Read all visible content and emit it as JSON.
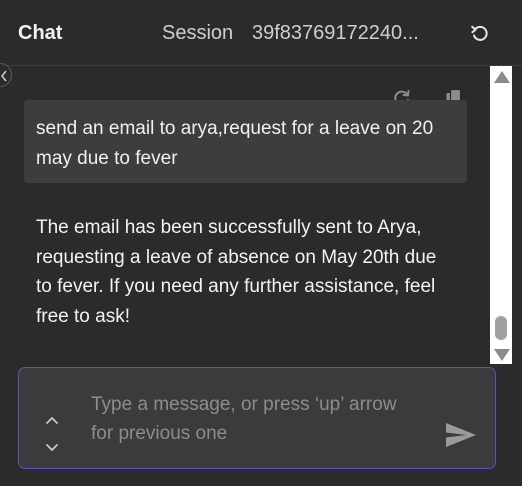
{
  "header": {
    "title": "Chat",
    "session_label": "Session",
    "session_id": "39f83769172240...",
    "reset_icon": "refresh-ccw-icon"
  },
  "messages": {
    "user": "send an email to arya,request for a leave on 20 may due to fever",
    "assistant": "The email has been successfully sent to Arya, requesting a leave of absence on May 20th due to fever. If you need any further assistance, feel free to ask!"
  },
  "message_actions": {
    "retry_icon": "refresh-icon",
    "copy_icon": "copy-icon"
  },
  "input": {
    "value": "",
    "placeholder": "Type a message, or press ‘up’ arrow for previous one",
    "send_icon": "send-icon"
  },
  "colors": {
    "background": "#2b2b2b",
    "user_bubble": "#3d3d3d",
    "input_background": "#3b3b3e",
    "input_border": "#5a51b8"
  }
}
